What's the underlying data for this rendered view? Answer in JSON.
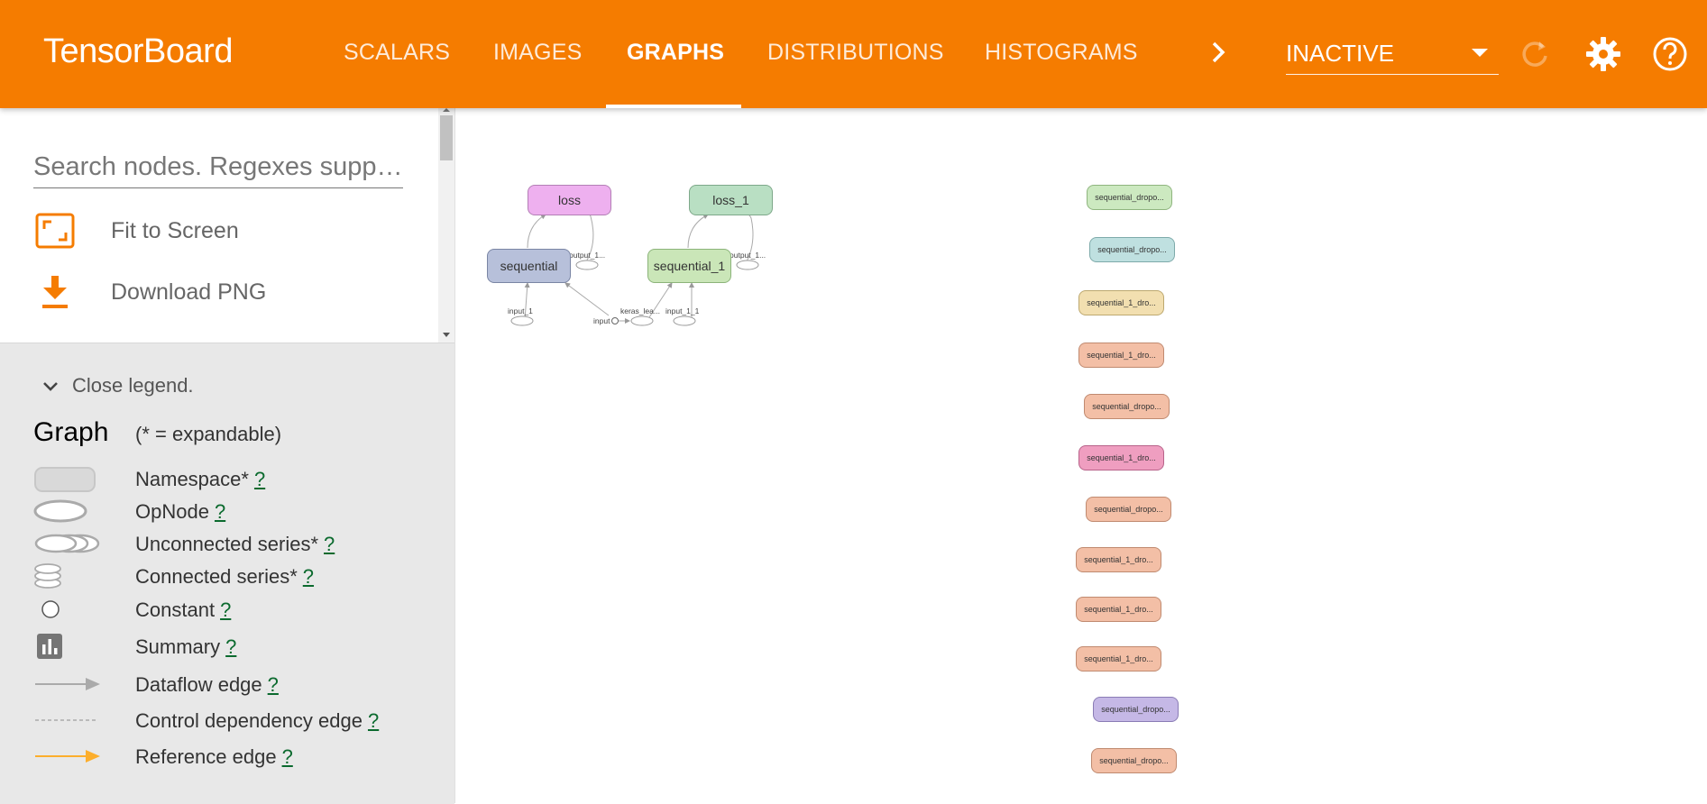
{
  "app": {
    "title": "TensorBoard"
  },
  "tabs": [
    {
      "label": "SCALARS",
      "active": false
    },
    {
      "label": "IMAGES",
      "active": false
    },
    {
      "label": "GRAPHS",
      "active": true
    },
    {
      "label": "DISTRIBUTIONS",
      "active": false
    },
    {
      "label": "HISTOGRAMS",
      "active": false
    }
  ],
  "header": {
    "run_selector": "INACTIVE",
    "icons": [
      "chevron-right-icon",
      "refresh-icon",
      "gear-icon",
      "help-icon"
    ]
  },
  "colors": {
    "brand": "#f57c00",
    "legend_bg": "#e8e8e8",
    "help_link": "#0b6a2e"
  },
  "sidebar": {
    "search_placeholder": "Search nodes. Regexes supp…",
    "fit_to_screen": "Fit to Screen",
    "download_png": "Download PNG"
  },
  "legend": {
    "toggle": "Close legend.",
    "title": "Graph",
    "subtitle": "(* = expandable)",
    "help": "?",
    "items": [
      "Namespace*",
      "OpNode",
      "Unconnected series*",
      "Connected series*",
      "Constant",
      "Summary",
      "Dataflow edge",
      "Control dependency edge",
      "Reference edge"
    ]
  },
  "graph": {
    "main_nodes": [
      {
        "label": "loss",
        "color": "#eeb0ef"
      },
      {
        "label": "loss_1",
        "color": "#b9dfc3"
      },
      {
        "label": "sequential",
        "color": "#b7c0da"
      },
      {
        "label": "sequential_1",
        "color": "#cae6b8"
      }
    ],
    "op_labels": [
      "output_1...",
      "output_1...",
      "input_1",
      "input",
      "keras_lea...",
      "input_1_1"
    ],
    "aux_nodes": [
      {
        "label": "sequential_dropo...",
        "color": "#cce9c0"
      },
      {
        "label": "sequential_dropo...",
        "color": "#bfe0e0"
      },
      {
        "label": "sequential_1_dro...",
        "color": "#f2dfb0"
      },
      {
        "label": "sequential_1_dro...",
        "color": "#f3bfa6"
      },
      {
        "label": "sequential_dropo...",
        "color": "#f3bfa6"
      },
      {
        "label": "sequential_1_dro...",
        "color": "#ef9ec0"
      },
      {
        "label": "sequential_dropo...",
        "color": "#f3bfa6"
      },
      {
        "label": "sequential_1_dro...",
        "color": "#f3bfa6"
      },
      {
        "label": "sequential_1_dro...",
        "color": "#f3bfa6"
      },
      {
        "label": "sequential_1_dro...",
        "color": "#f3bfa6"
      },
      {
        "label": "sequential_dropo...",
        "color": "#c5b8e6"
      },
      {
        "label": "sequential_dropo...",
        "color": "#f3bfa6"
      }
    ]
  }
}
